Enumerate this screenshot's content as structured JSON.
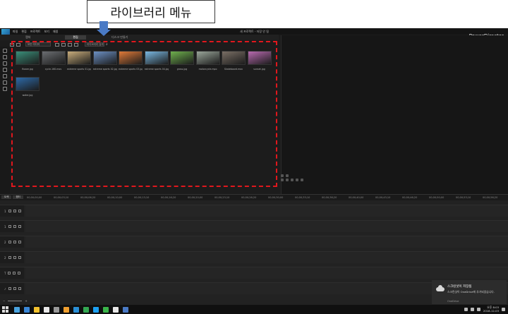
{
  "callout": {
    "label": "라이브러리 메뉴",
    "arrow_color": "#4a7ac5",
    "highlight_color": "#e0171d"
  },
  "app": {
    "menu": [
      "파일",
      "편집",
      "프로젝트",
      "보기",
      "재생"
    ],
    "window_title": "새 프로젝트 - 저장 안 됨",
    "brand": "PowerDirector"
  },
  "tabs": [
    "캡처",
    "편집",
    "디스크 만들기"
  ],
  "toolbar": {
    "filter_value": "모든 미디어",
    "search_placeholder": "라이브러리 검색"
  },
  "library": {
    "items": [
      {
        "name": "flower.jpg",
        "color": "#3a8f7a"
      },
      {
        "name": "cycle-160.mov",
        "color": "#6b6e72"
      },
      {
        "name": "extreme sports 01.jpg",
        "color": "#c9ad7c"
      },
      {
        "name": "extreme sports 02.jpg",
        "color": "#6c90c4"
      },
      {
        "name": "extreme sports 03.jpg",
        "color": "#e07a38"
      },
      {
        "name": "extreme sports 04.jpg",
        "color": "#7ab8e2"
      },
      {
        "name": "grass.jpg",
        "color": "#6fb14d"
      },
      {
        "name": "motorcycle.mpo",
        "color": "#9aa69a"
      },
      {
        "name": "Skateboard.mov",
        "color": "#7a6f65"
      },
      {
        "name": "sunset.jpg",
        "color": "#b86ab0"
      },
      {
        "name": "water.jpg",
        "color": "#2d6aa8"
      }
    ]
  },
  "timeline": {
    "tabs": [
      "트랙",
      "챕터"
    ],
    "ticks": [
      "00;00;00;00",
      "00;00;03;10",
      "00;00;06;20",
      "00;00;10;00",
      "00;00;13;10",
      "00;00;16;20",
      "00;00;20;00",
      "00;00;23;10",
      "00;00;26;20",
      "00;00;30;00",
      "00;00;33;10",
      "00;00;36;20",
      "00;00;40;00",
      "00;00;43;10",
      "00;00;46;20",
      "00;00;50;00",
      "00;00;53;10",
      "00;00;56;20"
    ],
    "tracks": [
      "1",
      "1",
      "2",
      "2",
      "T",
      "♪"
    ]
  },
  "toast": {
    "title": "스크린샷이 저장됨",
    "body": "스크린샷이 OneDrive에 추가되었습니다.",
    "app": "OneDrive"
  },
  "taskbar": {
    "icons": [
      "#4aa3df",
      "#3a87d6",
      "#f2c12e",
      "#e8e8e8",
      "#999999",
      "#f0a030",
      "#2a8fd6",
      "#33a852",
      "#1da1f2",
      "#3ab54a",
      "#e8e8e8",
      "#4a7ac5"
    ],
    "time": "오후 8:03",
    "date": "2018-12-03"
  }
}
